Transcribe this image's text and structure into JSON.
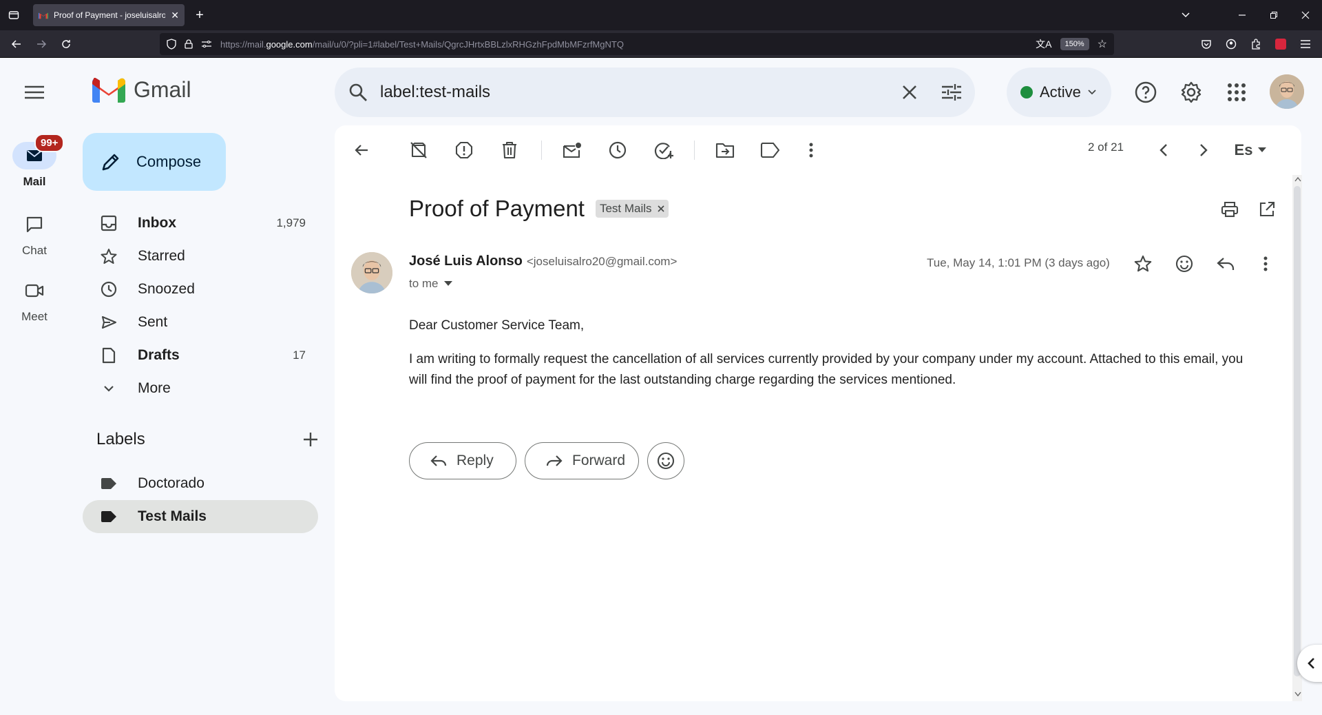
{
  "browser": {
    "tab_title": "Proof of Payment - joseluisalro",
    "url_prefix": "https://mail.",
    "url_domain": "google.com",
    "url_rest": "/mail/u/0/?pli=1#label/Test+Mails/QgrcJHrtxBBLzlxRHGzhFpdMbMFzrfMgNTQ",
    "zoom": "150%"
  },
  "header": {
    "app_name": "Gmail",
    "search_value": "label:test-mails",
    "status_label": "Active"
  },
  "rail": {
    "mail_label": "Mail",
    "mail_badge": "99+",
    "chat_label": "Chat",
    "meet_label": "Meet"
  },
  "nav": {
    "compose_label": "Compose",
    "items": [
      {
        "label": "Inbox",
        "count": "1,979"
      },
      {
        "label": "Starred",
        "count": ""
      },
      {
        "label": "Snoozed",
        "count": ""
      },
      {
        "label": "Sent",
        "count": ""
      },
      {
        "label": "Drafts",
        "count": "17"
      },
      {
        "label": "More",
        "count": ""
      }
    ],
    "labels_heading": "Labels",
    "labels": [
      {
        "label": "Doctorado"
      },
      {
        "label": "Test Mails"
      }
    ]
  },
  "toolbar": {
    "pager": "2 of 21",
    "input_tool": "Es"
  },
  "email": {
    "subject": "Proof of Payment",
    "label_chip": "Test Mails",
    "sender_name": "José Luis Alonso",
    "sender_email": "<joseluisalro20@gmail.com>",
    "to": "to me",
    "date": "Tue, May 14, 1:01 PM (3 days ago)",
    "greeting": "Dear Customer Service Team,",
    "body_line1": "I am writing to formally request the cancellation of all services currently provided by your company under my account. Attached to this email, you",
    "body_line2": "will find the proof of payment for the last outstanding charge regarding the services mentioned.",
    "reply_label": "Reply",
    "forward_label": "Forward"
  },
  "colors": {
    "accent_compose": "#c2e7ff",
    "search_bg": "#e9eef6",
    "status_green": "#1e8e3e",
    "badge_red": "#b3261e"
  }
}
